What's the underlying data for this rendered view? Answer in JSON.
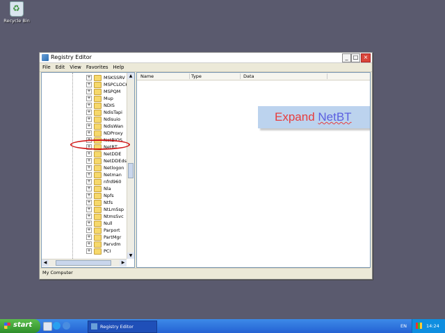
{
  "desktop": {
    "recycle_bin_label": "Recycle Bin"
  },
  "window": {
    "title": "Registry Editor",
    "controls": {
      "minimize": "_",
      "maximize": "□",
      "close": "×"
    },
    "menu": [
      "File",
      "Edit",
      "View",
      "Favorites",
      "Help"
    ],
    "tree_items": [
      "MSKSSRV",
      "MSPCLOCK",
      "MSPQM",
      "Mup",
      "NDIS",
      "NdisTapi",
      "Ndisuio",
      "NdisWan",
      "NDProxy",
      "NetBIOS",
      "NetBT",
      "NetDDE",
      "NetDDEdsdm",
      "Netlogon",
      "Netman",
      "nfrd960",
      "Nla",
      "Npfs",
      "Ntfs",
      "NtLmSsp",
      "NtmsSvc",
      "Null",
      "Parport",
      "PartMgr",
      "Parvdm",
      "PCI"
    ],
    "list_headers": {
      "name": "Name",
      "type": "Type",
      "data": "Data"
    },
    "statusbar": "My Computer"
  },
  "callout": {
    "prefix": "Expand ",
    "highlight": "NetBT"
  },
  "taskbar": {
    "start_label": "start",
    "task_label": "Registry Editor",
    "language": "EN",
    "clock": "14:24"
  }
}
